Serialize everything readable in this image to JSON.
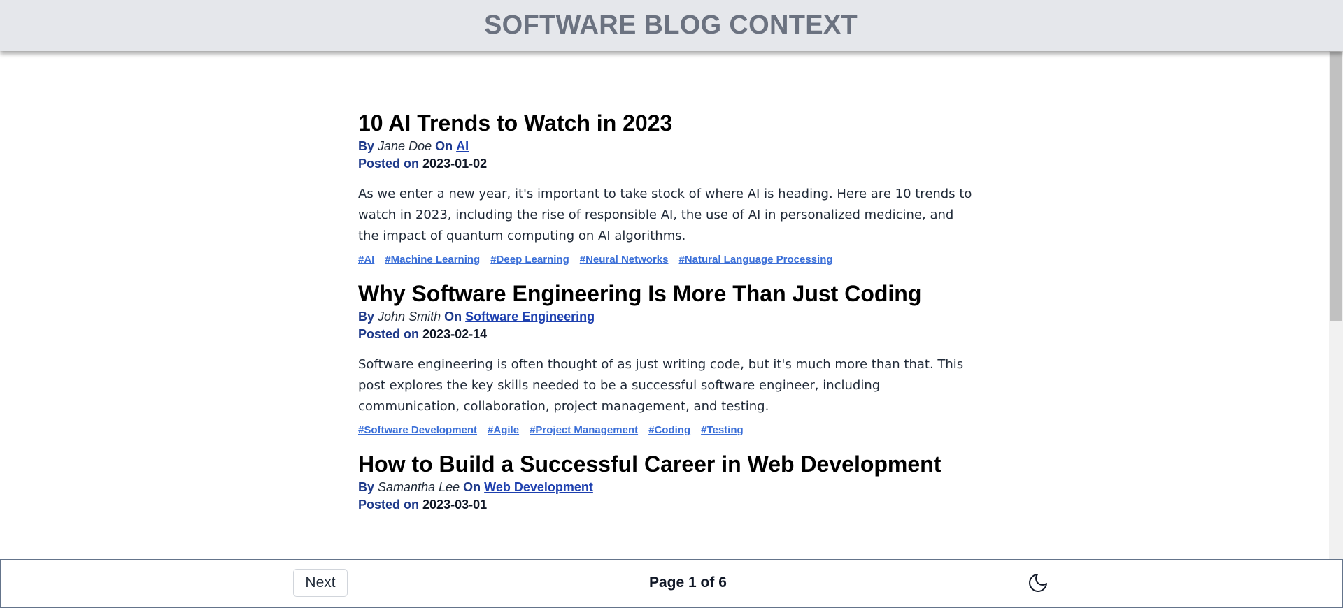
{
  "header": {
    "title": "SOFTWARE BLOG CONTEXT"
  },
  "posts": [
    {
      "title": "10 AI Trends to Watch in 2023",
      "by_label": "By",
      "author": "Jane Doe",
      "on_label": "On",
      "category": "AI",
      "posted_label": "Posted on",
      "date": "2023-01-02",
      "excerpt": "As we enter a new year, it's important to take stock of where AI is heading. Here are 10 trends to watch in 2023, including the rise of responsible AI, the use of AI in personalized medicine, and the impact of quantum computing on AI algorithms.",
      "tags": [
        "#AI",
        "#Machine Learning",
        "#Deep Learning",
        "#Neural Networks",
        "#Natural Language Processing"
      ]
    },
    {
      "title": "Why Software Engineering Is More Than Just Coding",
      "by_label": "By",
      "author": "John Smith",
      "on_label": "On",
      "category": "Software Engineering",
      "posted_label": "Posted on",
      "date": "2023-02-14",
      "excerpt": "Software engineering is often thought of as just writing code, but it's much more than that. This post explores the key skills needed to be a successful software engineer, including communication, collaboration, project management, and testing.",
      "tags": [
        "#Software Development",
        "#Agile",
        "#Project Management",
        "#Coding",
        "#Testing"
      ]
    },
    {
      "title": "How to Build a Successful Career in Web Development",
      "by_label": "By",
      "author": "Samantha Lee",
      "on_label": "On",
      "category": "Web Development",
      "posted_label": "Posted on",
      "date": "2023-03-01",
      "excerpt": "",
      "tags": []
    }
  ],
  "footer": {
    "next_label": "Next",
    "page_indicator": "Page 1 of 6",
    "theme_icon": "moon-icon"
  }
}
